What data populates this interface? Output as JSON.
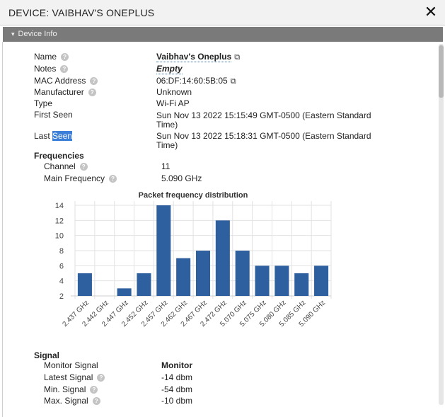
{
  "dialog": {
    "title": "Device: Vaibhav's Oneplus",
    "title_display": "DEVICE: VAIBHAV'S ONEPLUS",
    "close_glyph": "✕"
  },
  "section": {
    "label": "Device Info",
    "caret": "▾"
  },
  "info": {
    "name_label": "Name",
    "name_value": "Vaibhav's Oneplus",
    "notes_label": "Notes",
    "notes_value": "Empty",
    "mac_label": "MAC Address",
    "mac_value": "06:DF:14:60:5B:05",
    "manufacturer_label": "Manufacturer",
    "manufacturer_value": "Unknown",
    "type_label": "Type",
    "type_value": "Wi-Fi AP",
    "first_seen_label": "First Seen",
    "first_seen_value_line1": "Sun Nov 13 2022 15:15:49 GMT-0500 (Eastern Standard",
    "first_seen_value_line2": "Time)",
    "last_seen_label_a": "Last ",
    "last_seen_label_b": "Seen",
    "last_seen_value_line1": "Sun Nov 13 2022 15:18:31 GMT-0500 (Eastern Standard",
    "last_seen_value_line2": "Time)"
  },
  "frequencies": {
    "heading": "Frequencies",
    "channel_label": "Channel",
    "channel_value": "11",
    "main_freq_label": "Main Frequency",
    "main_freq_value": "5.090 GHz"
  },
  "signal": {
    "heading": "Signal",
    "monitor_label": "Monitor Signal",
    "monitor_value": "Monitor",
    "latest_label": "Latest Signal",
    "latest_value": "-14 dbm",
    "min_label": "Min. Signal",
    "min_value": "-54 dbm",
    "max_label": "Max. Signal",
    "max_value": "-10 dbm"
  },
  "chart_data": {
    "type": "bar",
    "title": "Packet frequency distribution",
    "categories": [
      "2.437 GHz",
      "2.442 GHz",
      "2.447 GHz",
      "2.452 GHz",
      "2.457 GHz",
      "2.462 GHz",
      "2.467 GHz",
      "2.472 GHz",
      "5.070 GHz",
      "5.075 GHz",
      "5.080 GHz",
      "5.085 GHz",
      "5.090 GHz"
    ],
    "values": [
      5,
      0,
      3,
      5,
      14,
      7,
      8,
      12,
      8,
      6,
      6,
      5,
      6
    ],
    "yticks": [
      2,
      4,
      6,
      8,
      10,
      12,
      14
    ],
    "ylim": [
      2,
      14
    ],
    "bar_color": "#2e5f9e",
    "grid": true
  }
}
